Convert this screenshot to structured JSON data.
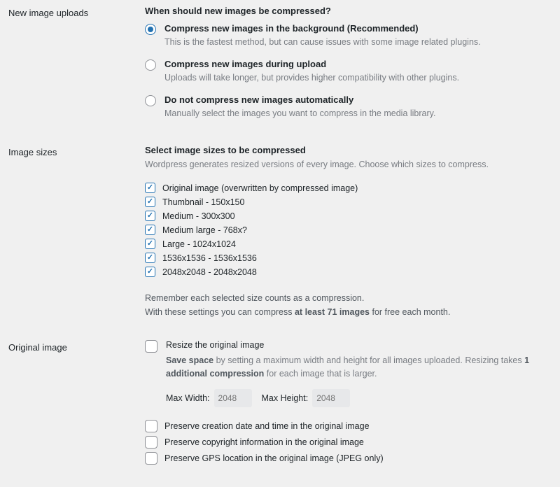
{
  "uploads": {
    "label": "New image uploads",
    "heading": "When should new images be compressed?",
    "options": [
      {
        "title": "Compress new images in the background (Recommended)",
        "desc": "This is the fastest method, but can cause issues with some image related plugins.",
        "selected": true
      },
      {
        "title": "Compress new images during upload",
        "desc": "Uploads will take longer, but provides higher compatibility with other plugins.",
        "selected": false
      },
      {
        "title": "Do not compress new images automatically",
        "desc": "Manually select the images you want to compress in the media library.",
        "selected": false
      }
    ]
  },
  "sizes": {
    "label": "Image sizes",
    "heading": "Select image sizes to be compressed",
    "sub": "Wordpress generates resized versions of every image. Choose which sizes to compress.",
    "items": [
      {
        "label": "Original image (overwritten by compressed image)",
        "checked": true
      },
      {
        "label": "Thumbnail - 150x150",
        "checked": true
      },
      {
        "label": "Medium - 300x300",
        "checked": true
      },
      {
        "label": "Medium large - 768x?",
        "checked": true
      },
      {
        "label": "Large - 1024x1024",
        "checked": true
      },
      {
        "label": "1536x1536 - 1536x1536",
        "checked": true
      },
      {
        "label": "2048x2048 - 2048x2048",
        "checked": true
      }
    ],
    "note1": "Remember each selected size counts as a compression.",
    "note2_pre": "With these settings you can compress ",
    "note2_bold": "at least 71 images",
    "note2_post": " for free each month."
  },
  "original": {
    "label": "Original image",
    "resize": {
      "checked": false,
      "title": "Resize the original image",
      "desc_bold1": "Save space",
      "desc_mid": " by setting a maximum width and height for all images uploaded. Resizing takes ",
      "desc_bold2": "1 additional compression",
      "desc_end": " for each image that is larger.",
      "max_width_label": "Max Width:",
      "max_width_value": "2048",
      "max_height_label": "Max Height:",
      "max_height_value": "2048"
    },
    "preserve": [
      {
        "label": "Preserve creation date and time in the original image",
        "checked": false
      },
      {
        "label": "Preserve copyright information in the original image",
        "checked": false
      },
      {
        "label": "Preserve GPS location in the original image (JPEG only)",
        "checked": false
      }
    ]
  }
}
